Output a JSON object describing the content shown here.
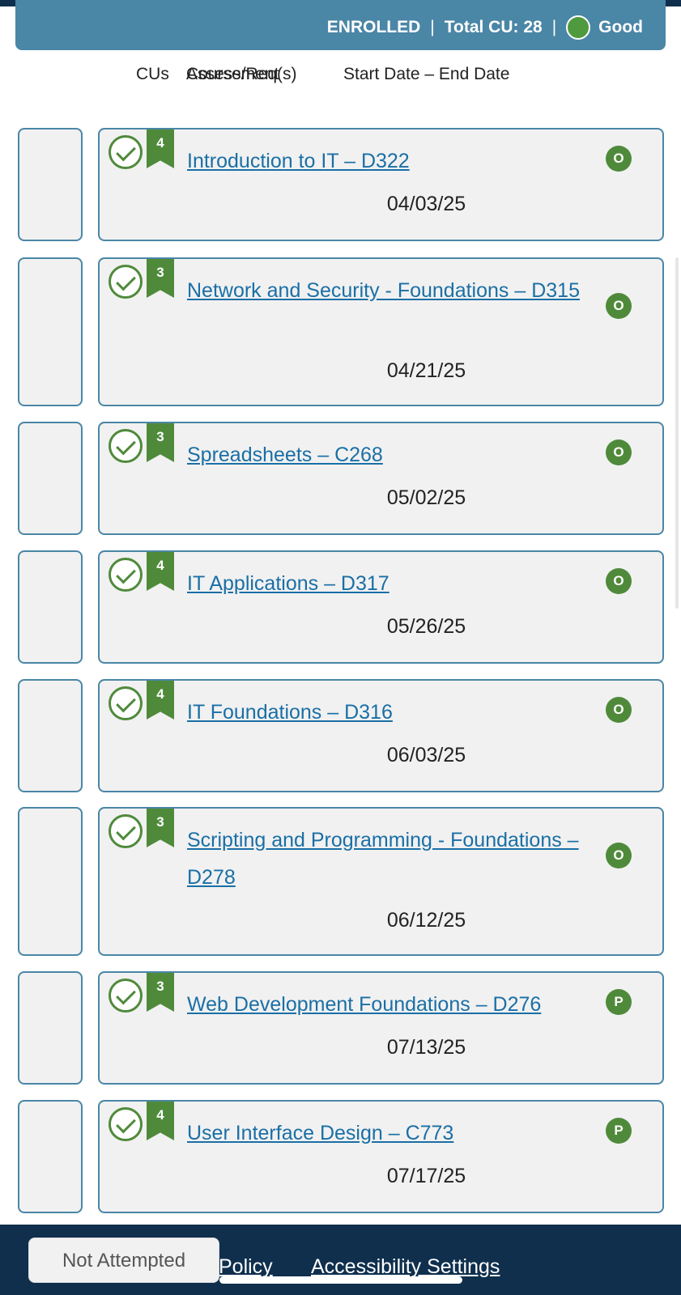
{
  "banner": {
    "enrolled": "ENROLLED",
    "sep1": "|",
    "total_cu": "Total CU: 28",
    "sep2": "|",
    "standing": "Good"
  },
  "headers": {
    "cus": "CUs",
    "course": "Course/Req(s)",
    "assessment": "Assessment",
    "dates": "Start Date – End Date"
  },
  "courses": [
    {
      "cu": "4",
      "title": "Introduction to IT – D322",
      "status": "O",
      "date": "04/03/25"
    },
    {
      "cu": "3",
      "title": "Network and Security - Foundations – D315",
      "status": "O",
      "date": "04/21/25"
    },
    {
      "cu": "3",
      "title": "Spreadsheets – C268",
      "status": "O",
      "date": "05/02/25"
    },
    {
      "cu": "4",
      "title": "IT Applications – D317",
      "status": "O",
      "date": "05/26/25"
    },
    {
      "cu": "4",
      "title": "IT Foundations – D316",
      "status": "O",
      "date": "06/03/25"
    },
    {
      "cu": "3",
      "title": "Scripting and Programming - Foundations – D278",
      "status": "O",
      "date": "06/12/25"
    },
    {
      "cu": "3",
      "title": "Web Development Foundations – D276",
      "status": "P",
      "date": "07/13/25"
    },
    {
      "cu": "4",
      "title": "User Interface Design – C773",
      "status": "P",
      "date": "07/17/25"
    }
  ],
  "footer": {
    "not_attempted": "Not Attempted",
    "policy": "Policy",
    "accessibility": "Accessibility Settings"
  },
  "colors": {
    "banner": "#4a86a6",
    "footer": "#0f2f4d",
    "complete_green": "#4f8a3b",
    "link": "#1a6fa6"
  }
}
